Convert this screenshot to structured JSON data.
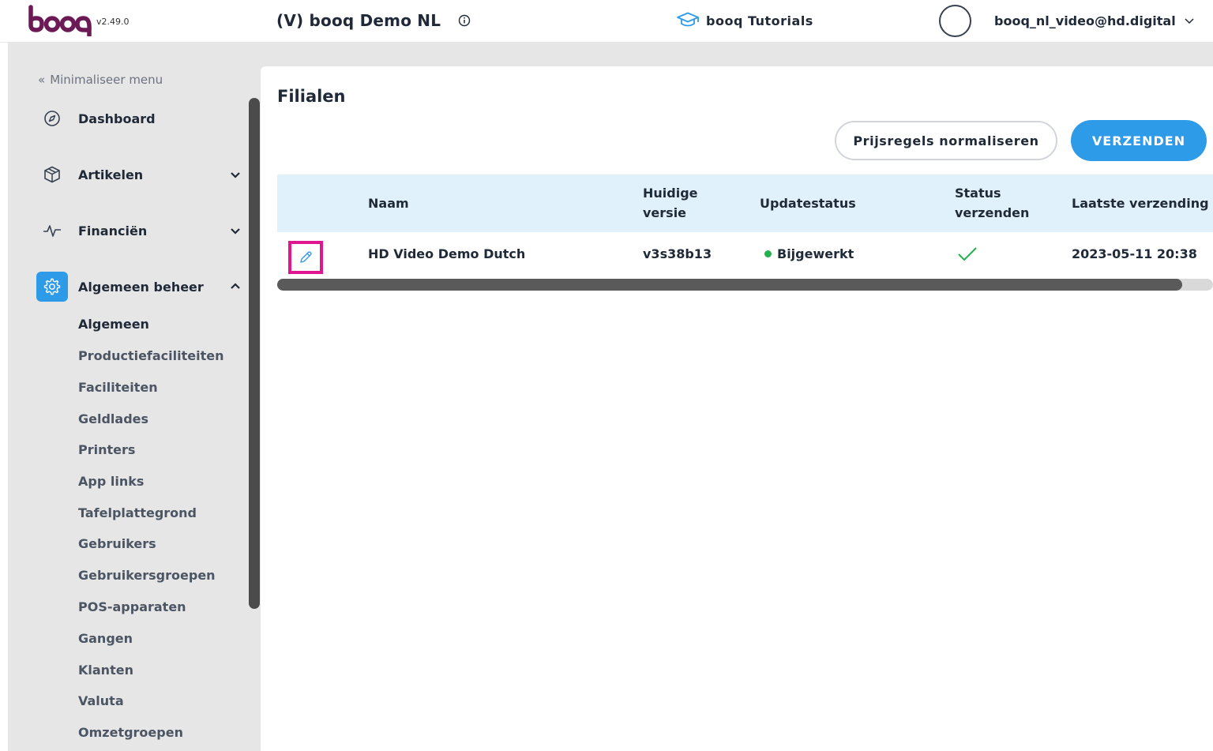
{
  "header": {
    "logo_text": "booq",
    "version": "v2.49.0",
    "venue": "(V) booq Demo NL",
    "tutorials_label": "booq Tutorials",
    "user_email": "booq_nl_video@hd.digital"
  },
  "sidebar": {
    "minimize_label": "Minimaliseer menu",
    "items": [
      {
        "label": "Dashboard",
        "icon": "compass-icon"
      },
      {
        "label": "Artikelen",
        "icon": "box-icon"
      },
      {
        "label": "Financiën",
        "icon": "pulse-icon"
      },
      {
        "label": "Algemeen beheer",
        "icon": "gear-icon"
      }
    ],
    "sub_items": [
      "Algemeen",
      "Productiefaciliteiten",
      "Faciliteiten",
      "Geldlades",
      "Printers",
      "App links",
      "Tafelplattegrond",
      "Gebruikers",
      "Gebruikersgroepen",
      "POS-apparaten",
      "Gangen",
      "Klanten",
      "Valuta",
      "Omzetgroepen"
    ]
  },
  "main": {
    "title": "Filialen",
    "normalize_button": "Prijsregels normaliseren",
    "send_button": "VERZENDEN",
    "columns": {
      "naam": "Naam",
      "versie_1": "Huidige",
      "versie_2": "versie",
      "updatestatus": "Updatestatus",
      "status_1": "Status",
      "status_2": "verzenden",
      "laatste": "Laatste verzending"
    },
    "rows": [
      {
        "naam": "HD Video Demo Dutch",
        "versie": "v3s38b13",
        "updatestatus": "Bijgewerkt",
        "laatste": "2023-05-11 20:38"
      }
    ]
  },
  "colors": {
    "accent": "#2e9be8",
    "highlight": "#e0168f",
    "success": "#22b14c",
    "brand": "#6b1a55"
  }
}
